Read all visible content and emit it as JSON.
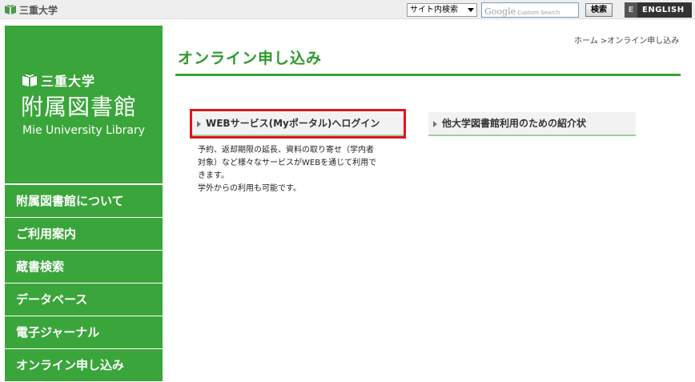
{
  "topbar": {
    "univ_name": "三重大学",
    "scope_select": "サイト内検索",
    "search_google": "Google",
    "search_custom": "Custom Search",
    "search_button": "検索",
    "english_prefix": "E",
    "english_label": "ENGLISH"
  },
  "brand": {
    "univ": "三重大学",
    "library": "附属図書館",
    "english": "Mie University Library",
    "color": "#3aa53a"
  },
  "nav": {
    "items": [
      {
        "label": "附属図書館について"
      },
      {
        "label": "ご利用案内"
      },
      {
        "label": "蔵書検索"
      },
      {
        "label": "データベース"
      },
      {
        "label": "電子ジャーナル"
      },
      {
        "label": "オンライン申し込み"
      }
    ]
  },
  "main": {
    "breadcrumb": "ホーム >オンライン申し込み",
    "title": "オンライン申し込み",
    "card1": "WEBサービス(Myポータル)へログイン",
    "card2": "他大学図書館利用のための紹介状",
    "desc_lines": [
      "予約、返却期限の延長、資料の取り寄せ（学内者",
      "対象）など様々なサービスがWEBを通じて利用で",
      "きます。",
      "学外からの利用も可能です。"
    ],
    "highlight_color": "#e0141e"
  }
}
